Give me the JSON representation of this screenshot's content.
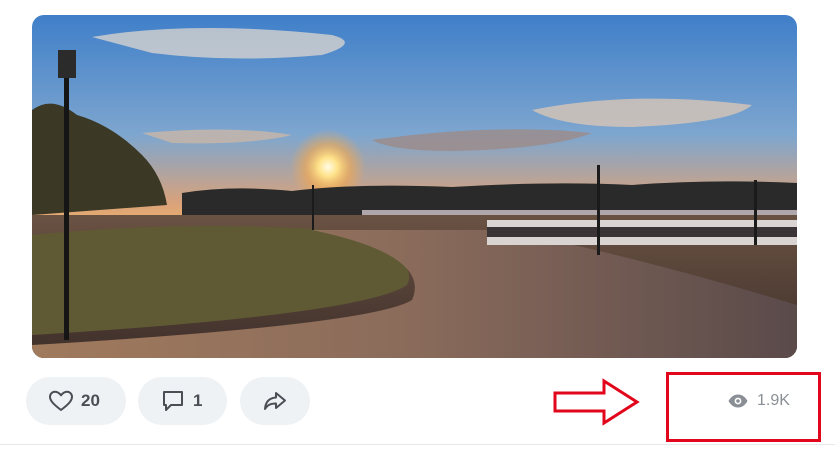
{
  "post": {
    "photo": {
      "icon": "sunset-promenade-photo"
    },
    "actions": {
      "likes": {
        "icon": "heart-icon",
        "count": "20"
      },
      "comments": {
        "icon": "comment-icon",
        "count": "1"
      },
      "share": {
        "icon": "share-arrow-icon"
      }
    },
    "views": {
      "icon": "eye-icon",
      "count": "1.9K"
    }
  },
  "annotation": {
    "color": "#e1061b",
    "arrow_icon": "right-arrow-outline",
    "box": "highlight-box"
  }
}
